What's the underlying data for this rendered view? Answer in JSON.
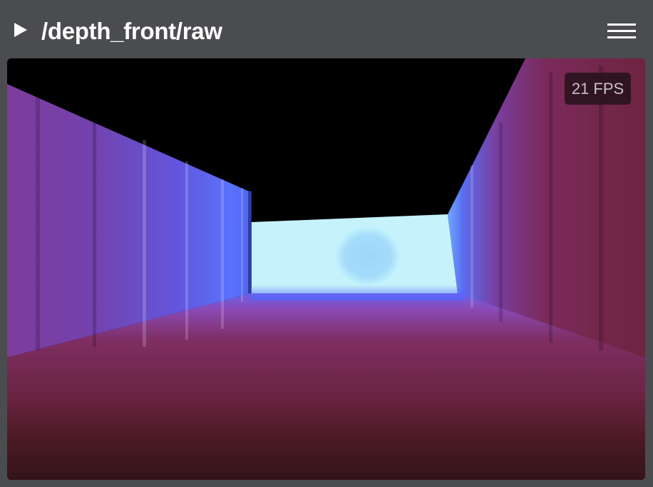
{
  "header": {
    "title": "/depth_front/raw",
    "play_icon": "play-triangle-icon",
    "menu_icon": "hamburger-menu-icon"
  },
  "viewer": {
    "fps_label": "21 FPS",
    "colors": {
      "near": "#c6f2fb",
      "mid": "#5a6af0",
      "far_wall": "#7a2a52",
      "floor_dark": "#3a161c",
      "empty": "#000000"
    }
  }
}
